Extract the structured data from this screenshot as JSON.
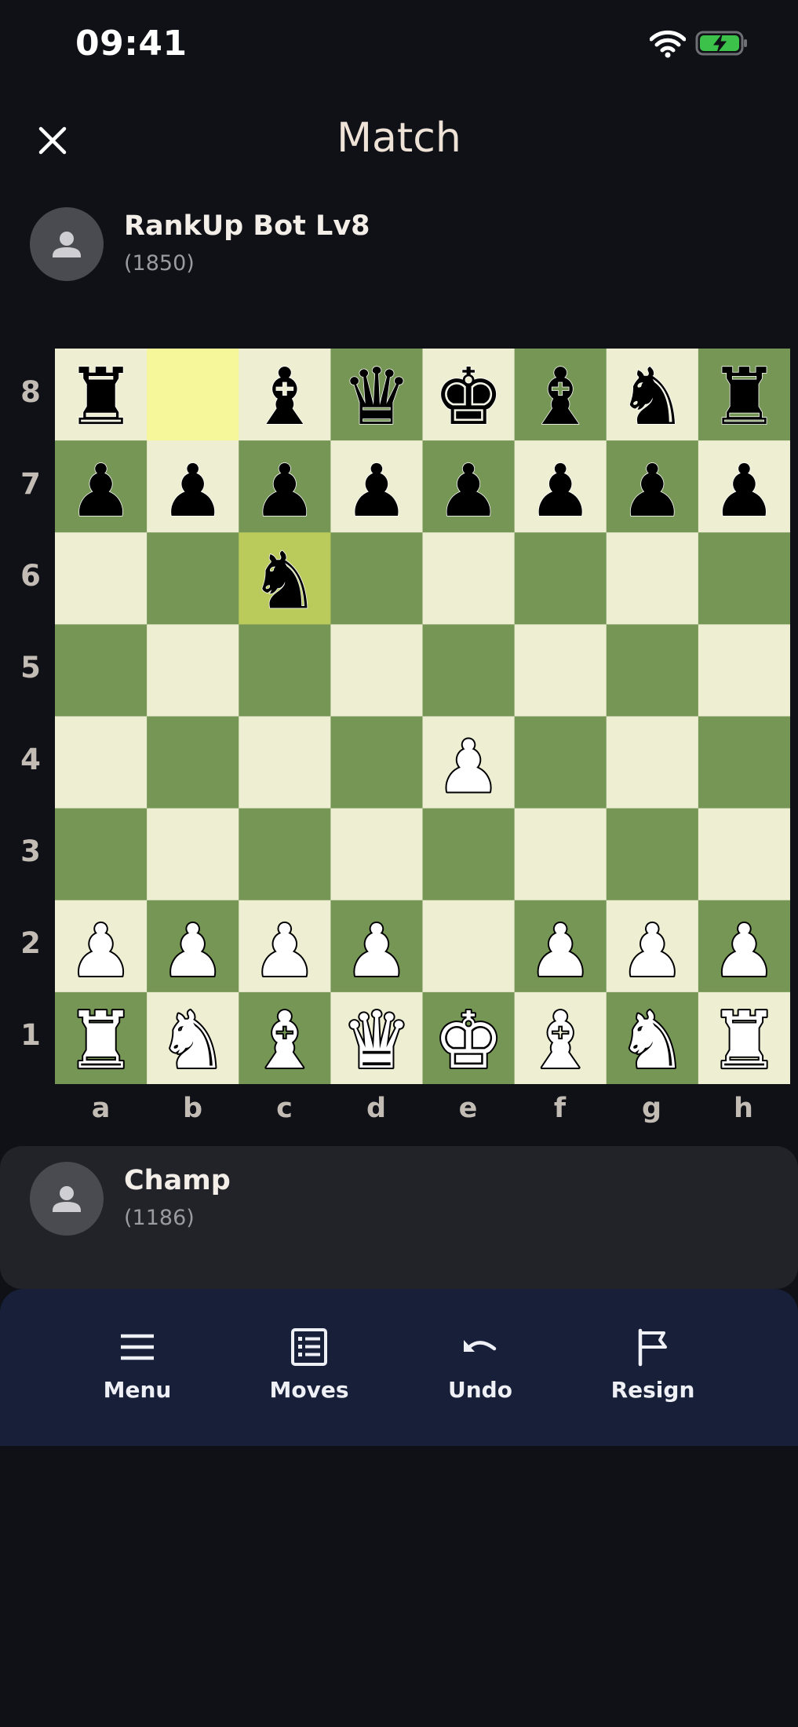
{
  "status_bar": {
    "time": "09:41",
    "wifi_icon": "wifi-icon",
    "battery_icon": "battery-charging-icon",
    "battery_color": "#3cc24a"
  },
  "header": {
    "title": "Match",
    "close_icon": "close-icon"
  },
  "opponent": {
    "name": "RankUp Bot Lv8",
    "rating": "(1850)",
    "avatar_icon": "person-icon"
  },
  "player": {
    "name": "Champ",
    "rating": "(1186)",
    "avatar_icon": "person-icon"
  },
  "board": {
    "files": [
      "a",
      "b",
      "c",
      "d",
      "e",
      "f",
      "g",
      "h"
    ],
    "ranks": [
      "8",
      "7",
      "6",
      "5",
      "4",
      "3",
      "2",
      "1"
    ],
    "light_color": "#eeeed2",
    "dark_color": "#769656",
    "highlight_from_color": "#f6f69b",
    "highlight_to_color": "#baca5b",
    "last_move": {
      "from": "b8",
      "to": "c6"
    },
    "position": [
      [
        "r",
        "",
        "b",
        "q",
        "k",
        "b",
        "n",
        "r"
      ],
      [
        "p",
        "p",
        "p",
        "p",
        "p",
        "p",
        "p",
        "p"
      ],
      [
        "",
        "",
        "n",
        "",
        "",
        "",
        "",
        ""
      ],
      [
        "",
        "",
        "",
        "",
        "",
        "",
        "",
        ""
      ],
      [
        "",
        "",
        "",
        "",
        "P",
        "",
        "",
        ""
      ],
      [
        "",
        "",
        "",
        "",
        "",
        "",
        "",
        ""
      ],
      [
        "P",
        "P",
        "P",
        "P",
        "",
        "P",
        "P",
        "P"
      ],
      [
        "R",
        "N",
        "B",
        "Q",
        "K",
        "B",
        "N",
        "R"
      ]
    ]
  },
  "toolbar": {
    "items": [
      {
        "label": "Menu",
        "icon": "menu-icon"
      },
      {
        "label": "Moves",
        "icon": "moves-list-icon"
      },
      {
        "label": "Undo",
        "icon": "undo-icon"
      },
      {
        "label": "Resign",
        "icon": "flag-icon"
      }
    ]
  }
}
